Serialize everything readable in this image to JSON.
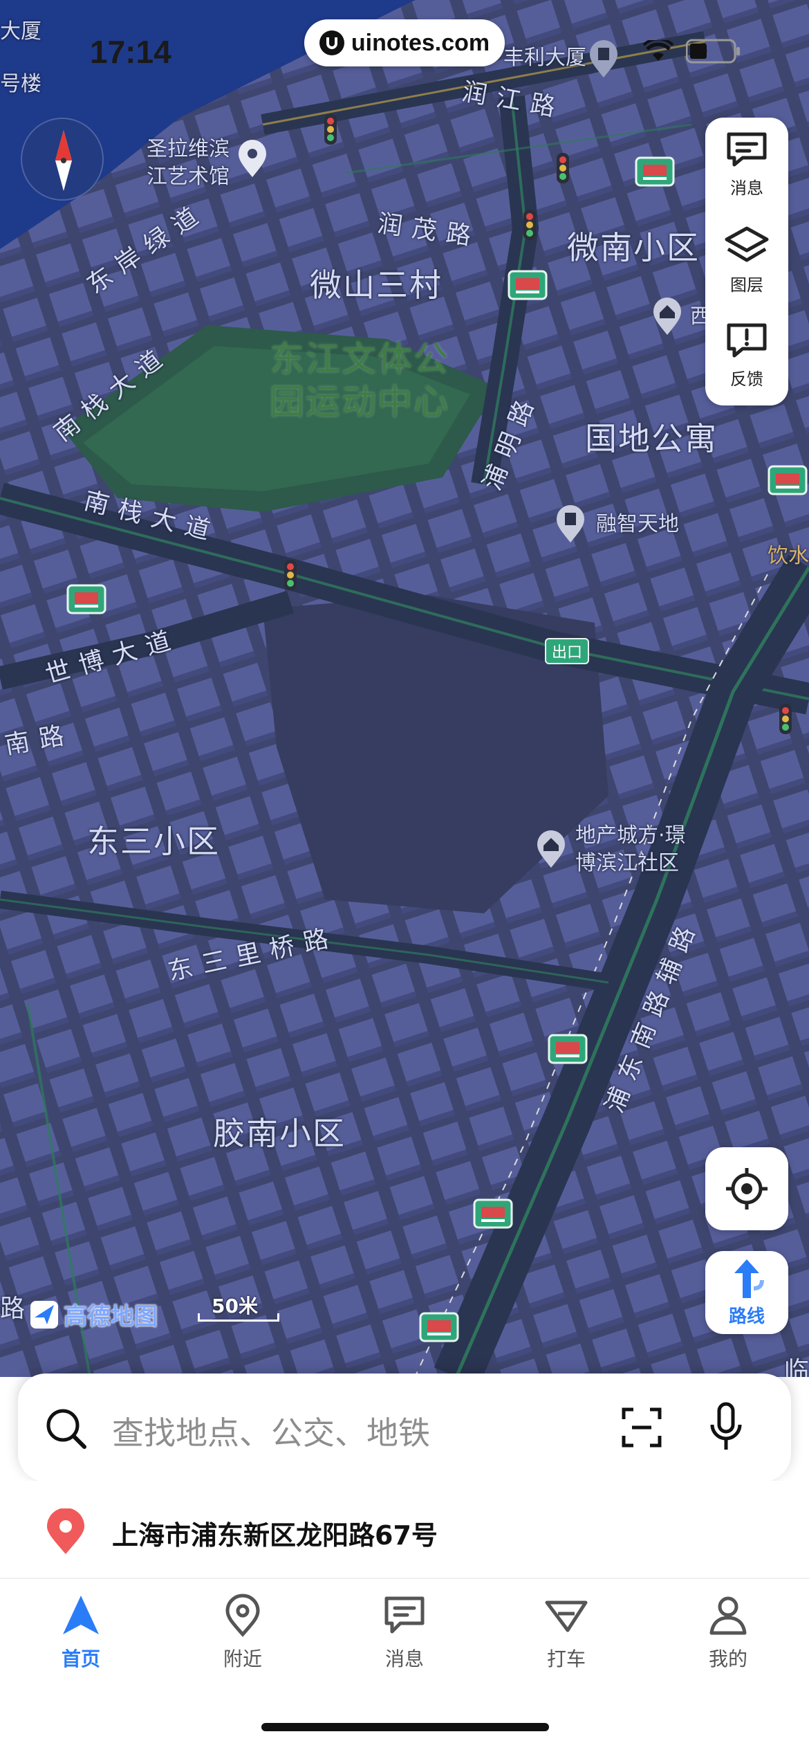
{
  "status_bar": {
    "time": "17:14",
    "watermark": "uinotes.com"
  },
  "map": {
    "area_labels": [
      "微山三村",
      "微南小区",
      "国地公寓",
      "东三小区",
      "胶南小区"
    ],
    "park_label_lines": [
      "东江文体公",
      "园运动中心"
    ],
    "road_labels": {
      "runjiang": "润江路",
      "runmao": "润茂路",
      "dongan": "东岸绿道",
      "nanzhan1": "南栈大道",
      "nanzhan2": "南栈大道",
      "pumin": "浦明路",
      "shibo": "世博大道",
      "nan_road": "南路",
      "dongsanliqiao": "东三里桥路",
      "pudongnan": "浦东南路辅路"
    },
    "poi_labels": {
      "art_museum": [
        "圣拉维滨",
        "江艺术馆"
      ],
      "fengli": "丰利大厦",
      "rongzhi": "融智天地",
      "dichan": [
        "地产城方·璟",
        "博滨江社区"
      ],
      "xi": "西",
      "yinshui": "饮水",
      "dasha": "大厦",
      "haolou": "号楼",
      "lu": "路",
      "lin": "临"
    },
    "exit_badge": "出口",
    "brand": "高德地图",
    "scale": "50米"
  },
  "tools": {
    "message": "消息",
    "layers": "图层",
    "feedback": "反馈",
    "route": "路线"
  },
  "search": {
    "placeholder": "查找地点、公交、地铁"
  },
  "location": {
    "address": "上海市浦东新区龙阳路67号"
  },
  "tabs": [
    {
      "label": "首页",
      "icon": "navigation-arrow-icon",
      "active": true
    },
    {
      "label": "附近",
      "icon": "map-pin-icon",
      "active": false
    },
    {
      "label": "消息",
      "icon": "message-icon",
      "active": false
    },
    {
      "label": "打车",
      "icon": "taxi-icon",
      "active": false
    },
    {
      "label": "我的",
      "icon": "user-icon",
      "active": false
    }
  ],
  "colors": {
    "accent": "#2a7cf7",
    "map_bg": "#3a4266",
    "river": "#1e3a8a",
    "park": "#2d5a4a",
    "road": "#2a3552"
  }
}
